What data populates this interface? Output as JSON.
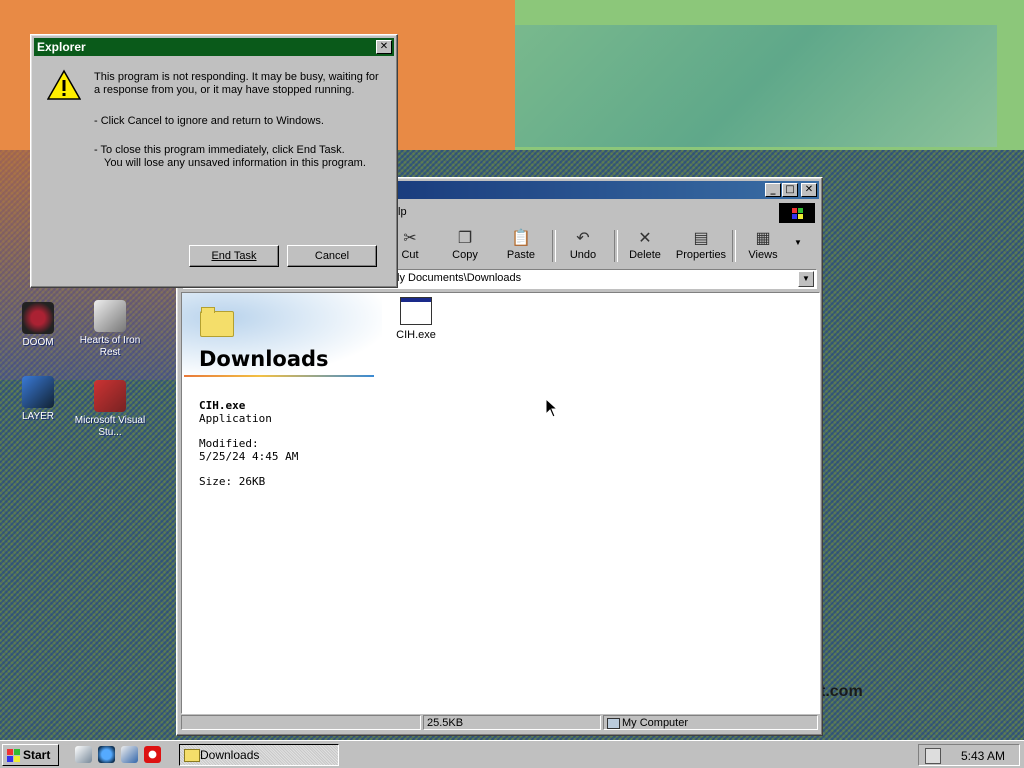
{
  "desktop": {
    "icons": [
      {
        "label": "DOOM"
      },
      {
        "label": "Hearts of Iron Rest"
      },
      {
        "label": "LAYER"
      },
      {
        "label": "Microsoft Visual Stu..."
      }
    ],
    "watermark_fragment": "t.com"
  },
  "dialog": {
    "title": "Explorer",
    "line1": "This program is not responding. It may be busy, waiting for a response from you, or it may have stopped running.",
    "line2": "-  Click Cancel to ignore and return to Windows.",
    "line3a": "-  To close this program immediately, click End Task.",
    "line3b": "You will lose any unsaved information in this program.",
    "end_task_label": "End Task",
    "cancel_label": "Cancel",
    "close_glyph": "✕"
  },
  "explorer": {
    "menu_visible": "lp",
    "toolbar": [
      {
        "name": "cut",
        "label": "Cut",
        "glyph": "✂"
      },
      {
        "name": "copy",
        "label": "Copy",
        "glyph": "❐"
      },
      {
        "name": "paste",
        "label": "Paste",
        "glyph": "📋"
      },
      {
        "name": "undo",
        "label": "Undo",
        "glyph": "↶"
      },
      {
        "name": "delete",
        "label": "Delete",
        "glyph": "✕"
      },
      {
        "name": "properties",
        "label": "Properties",
        "glyph": "▤"
      },
      {
        "name": "views",
        "label": "Views",
        "glyph": "▦"
      }
    ],
    "address": "ly Documents\\Downloads",
    "pane": {
      "title": "Downloads",
      "file_name": "CIH.exe",
      "file_type": "Application",
      "modified_label": "Modified:",
      "modified_value": "5/25/24 4:45 AM",
      "size": "Size: 26KB"
    },
    "files": [
      {
        "name": "CIH.exe"
      }
    ],
    "status": {
      "size": "25.5KB",
      "location": "My Computer"
    }
  },
  "taskbar": {
    "start_label": "Start",
    "task_label": "Downloads",
    "clock": "5:43 AM"
  },
  "colors": {
    "dialog_title": "#0a5a1a",
    "window_title": "#0a246a",
    "face": "#c0c0c0"
  }
}
